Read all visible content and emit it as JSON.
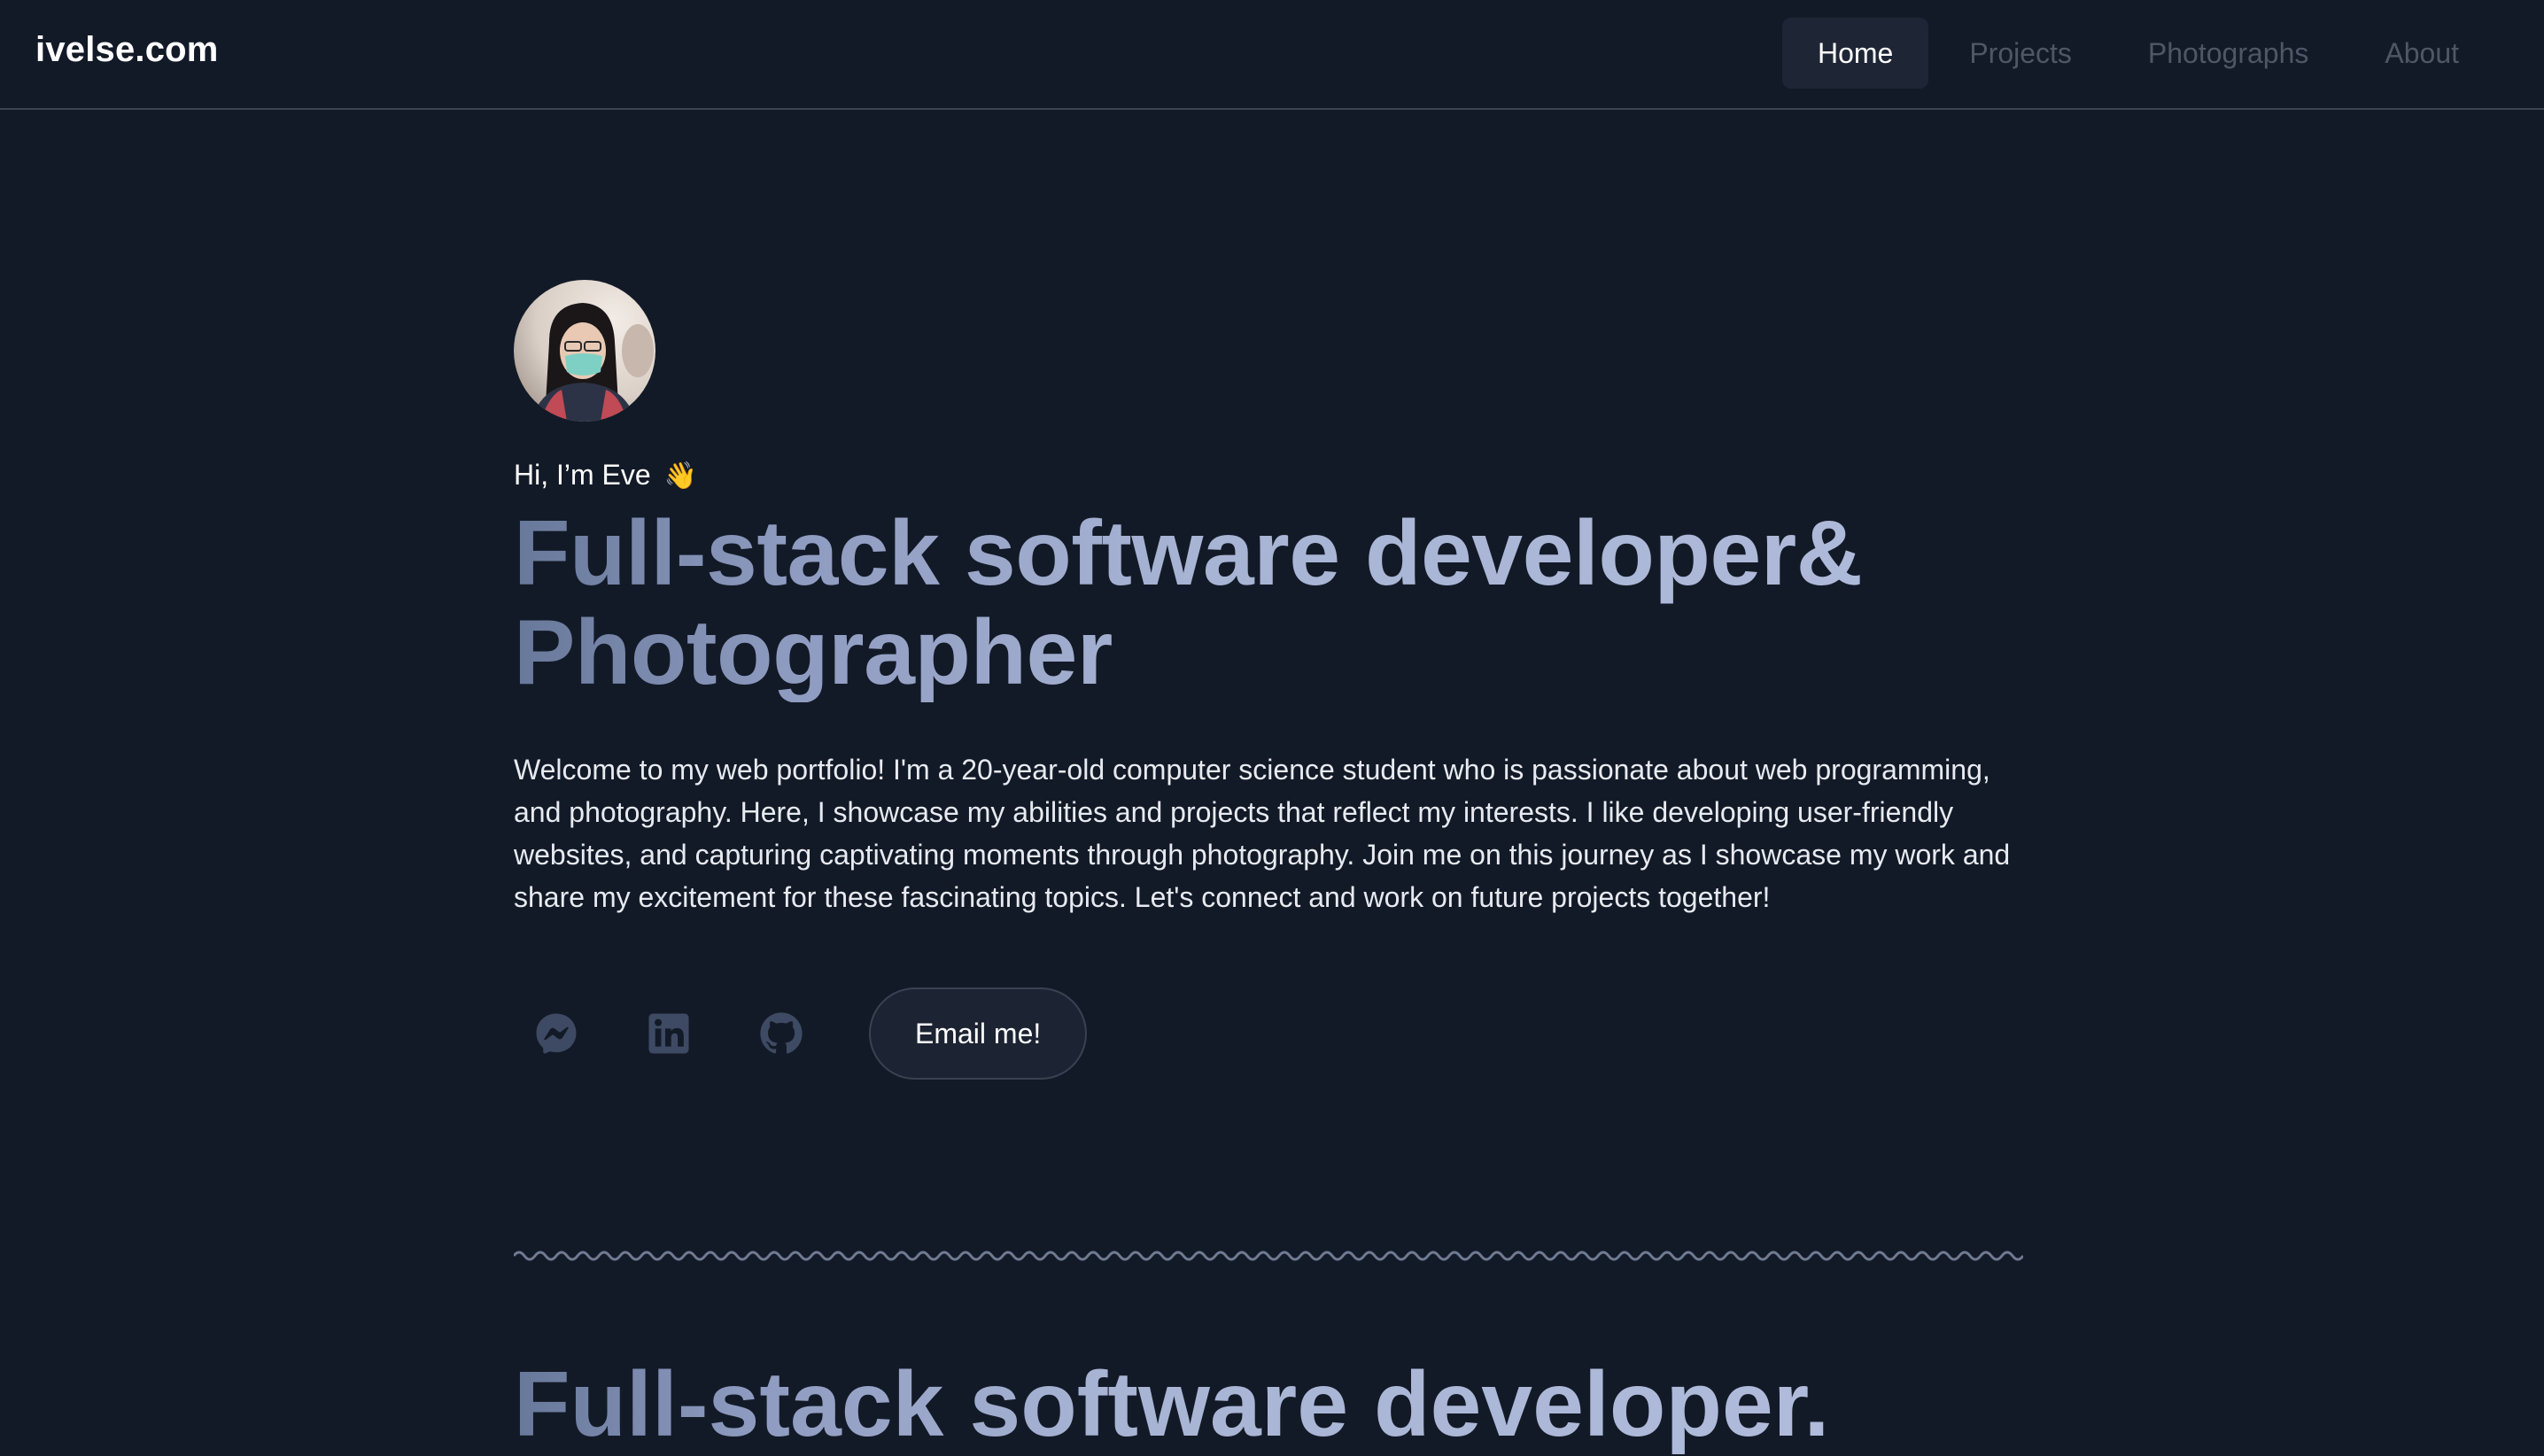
{
  "header": {
    "brand": "ivelse.com",
    "nav": [
      {
        "label": "Home",
        "active": true
      },
      {
        "label": "Projects",
        "active": false
      },
      {
        "label": "Photographs",
        "active": false
      },
      {
        "label": "About",
        "active": false
      }
    ]
  },
  "hero": {
    "greeting": "Hi, I’m Eve",
    "wave_emoji": "👋",
    "headline_line1": "Full-stack software developer&",
    "headline_line2": "Photographer",
    "intro": "Welcome to my web portfolio! I'm a 20-year-old computer science student who is passionate about web programming, and photography. Here, I showcase my abilities and projects that reflect my interests. I like developing user-friendly websites, and capturing captivating moments through photography. Join me on this journey as I showcase my work and share my excitement for these fascinating topics. Let's connect and work on future projects together!",
    "social_icons": [
      "messenger-icon",
      "linkedin-icon",
      "github-icon"
    ],
    "email_button": "Email me!"
  },
  "next_section": {
    "heading": "Full-stack software developer."
  },
  "colors": {
    "background": "#131a27",
    "nav_active_bg": "#1e2636",
    "nav_inactive_text": "#4f5665",
    "icon_color": "#3e4a63",
    "heading_gradient_start": "#67789a",
    "heading_gradient_end": "#b0bbdb"
  }
}
